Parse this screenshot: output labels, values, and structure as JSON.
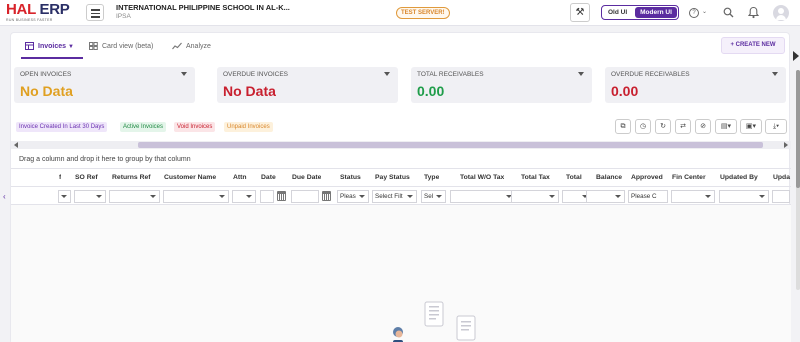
{
  "brand": {
    "logo_main": "HAL",
    "logo_accent": "ERP",
    "tagline": "RUN BUSINESS FASTER"
  },
  "header": {
    "school": "INTERNATIONAL PHILIPPINE SCHOOL IN AL-K...",
    "school_short": "IPSA",
    "server_badge": "TEST SERVER!",
    "old_ui": "Old UI",
    "modern_ui": "Modern UI"
  },
  "tabs": [
    {
      "label": "Invoices",
      "active": true
    },
    {
      "label": "Card view (beta)",
      "active": false
    },
    {
      "label": "Analyze",
      "active": false
    }
  ],
  "create_new": "+ CREATE NEW",
  "kpis": [
    {
      "label": "OPEN INVOICES",
      "value": "No Data",
      "color": "#e0a021"
    },
    {
      "label": "OVERDUE INVOICES",
      "value": "No Data",
      "color": "#c8202f"
    },
    {
      "label": "TOTAL RECEIVABLES",
      "value": "0.00",
      "color": "#1f9d4a"
    },
    {
      "label": "OVERDUE RECEIVABLES",
      "value": "0.00",
      "color": "#c8202f"
    }
  ],
  "filter_chips": [
    {
      "label": "Invoice Created In Last 30 Days",
      "fg": "#6a2fb0",
      "bg": "#efe6fa"
    },
    {
      "label": "Active Invoices",
      "fg": "#1f8a43",
      "bg": "#e4f5ea"
    },
    {
      "label": "Void Invoices",
      "fg": "#c8202f",
      "bg": "#fbe5e7"
    },
    {
      "label": "Unpaid Invoices",
      "fg": "#d9862a",
      "bg": "#fdf1dc"
    }
  ],
  "group_panel_text": "Drag a column and drop it here to group by that column",
  "columns": [
    "f",
    "SO Ref",
    "Returns Ref",
    "Customer Name",
    "Attn",
    "Date",
    "Due Date",
    "Status",
    "Pay Status",
    "Type",
    "Total W/O Tax",
    "Total Tax",
    "Total",
    "Balance",
    "Approved",
    "Fin Center",
    "Updated By",
    "Upda"
  ],
  "filters": {
    "status": "Pleas",
    "pay_status": "Select Filt",
    "type": "Sel",
    "approved": "Please C"
  }
}
